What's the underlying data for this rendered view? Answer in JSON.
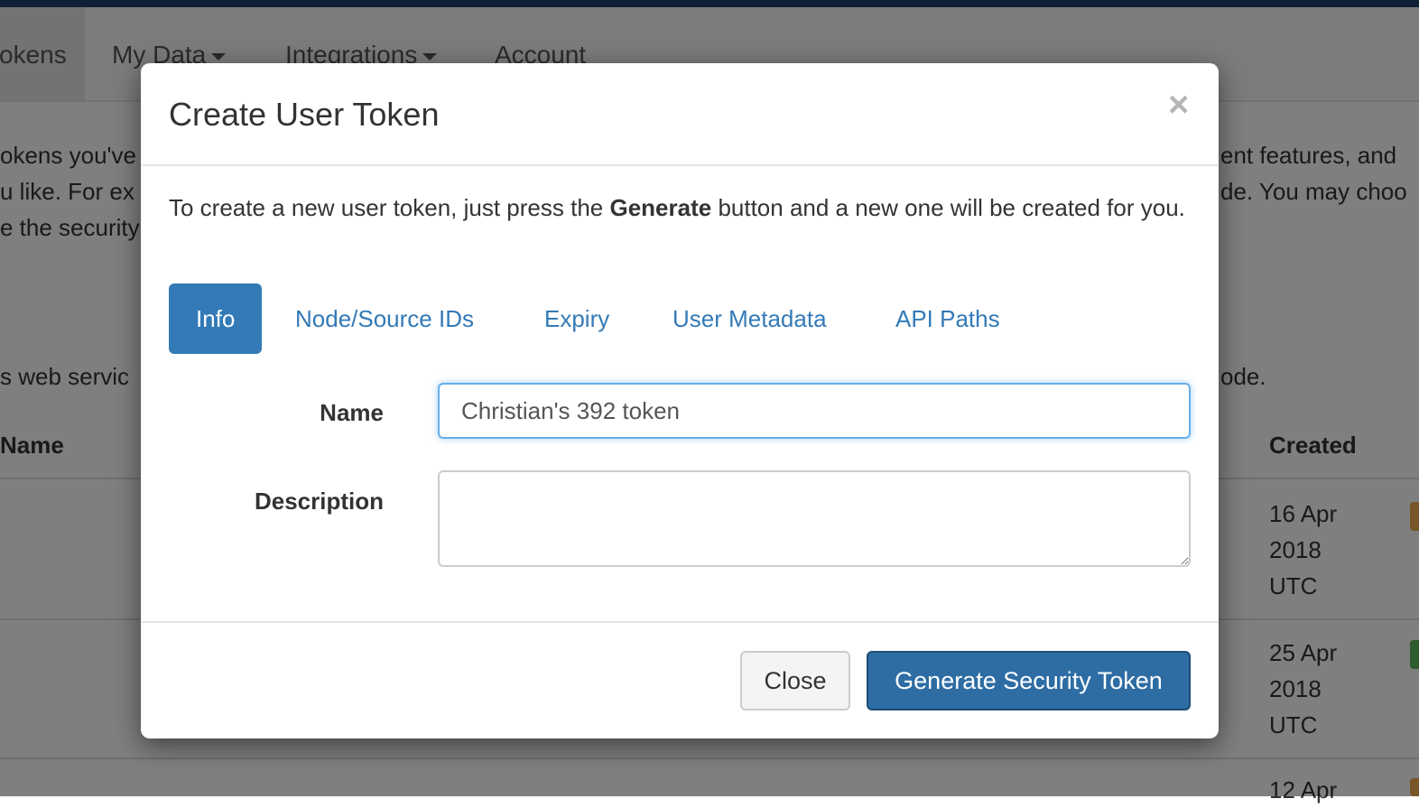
{
  "nav": {
    "items": [
      {
        "label": "okens"
      },
      {
        "label": "My Data"
      },
      {
        "label": "Integrations"
      },
      {
        "label": "Account"
      }
    ]
  },
  "background": {
    "paragraph_left": [
      "okens you've",
      "u like. For ex",
      "e the security"
    ],
    "paragraph_right": [
      "ent features, and",
      "de. You may choo"
    ],
    "service_left": "s web servic",
    "service_right": "ode.",
    "table": {
      "headers": {
        "name": "Name",
        "created": "Created"
      },
      "rows": [
        {
          "created": [
            "16 Apr",
            "2018",
            "UTC"
          ],
          "status_color": "#f0ad4e"
        },
        {
          "created": [
            "25 Apr",
            "2018",
            "UTC"
          ],
          "status_color": "#5cb85c"
        },
        {
          "created": [
            "12 Apr"
          ],
          "status_color": "#f0ad4e"
        }
      ]
    }
  },
  "modal": {
    "title": "Create User Token",
    "close_symbol": "×",
    "intro": {
      "before": "To create a new user token, just press the ",
      "bold": "Generate",
      "after": " button and a new one will be created for you."
    },
    "tabs": [
      {
        "label": "Info",
        "active": true
      },
      {
        "label": "Node/Source IDs",
        "active": false
      },
      {
        "label": "Expiry",
        "active": false
      },
      {
        "label": "User Metadata",
        "active": false
      },
      {
        "label": "API Paths",
        "active": false
      }
    ],
    "form": {
      "name_label": "Name",
      "name_value": "Christian's 392 token",
      "description_label": "Description",
      "description_value": ""
    },
    "buttons": {
      "close": "Close",
      "generate": "Generate Security Token"
    }
  },
  "colors": {
    "primary": "#337ab7",
    "primary_dark": "#2e6da4",
    "brand_bar": "#1f3f6b"
  }
}
